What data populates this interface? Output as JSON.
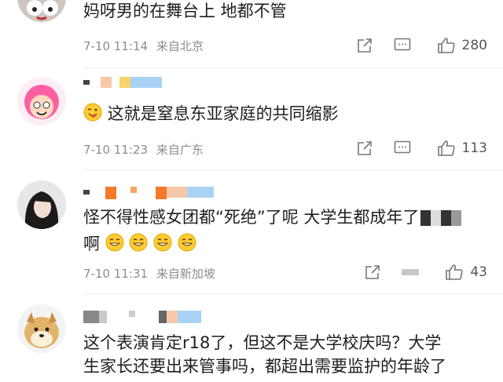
{
  "comments": [
    {
      "text": "妈呀男的在舞台上  地都不管",
      "time": "7-10 11:14",
      "location": "来自北京",
      "likes": "280"
    },
    {
      "text": "这就是窒息东亚家庭的共同缩影",
      "time": "7-10 11:23",
      "location": "来自广东",
      "likes": "113"
    },
    {
      "text_line1": "怪不得性感女团都“死绝”了呢 大学生都成年了",
      "text_line2": "啊",
      "time": "7-10 11:31",
      "location": "来自新加坡",
      "likes": "43"
    },
    {
      "text_line1": "这个表演肯定r18了，但这不是大学校庆吗？大学",
      "text_line2": "生家长还要出来管事吗，都超出需要监护的年龄了"
    }
  ],
  "icons": {
    "share": "share-icon",
    "comment": "comment-icon",
    "like": "thumbs-up-icon"
  },
  "colors": {
    "meta_text": "#8c8c8c",
    "body_text": "#1e1e1e",
    "icon": "#777777",
    "mosaic_orange": "#f7a35c",
    "mosaic_blue": "#a9d3f5"
  }
}
